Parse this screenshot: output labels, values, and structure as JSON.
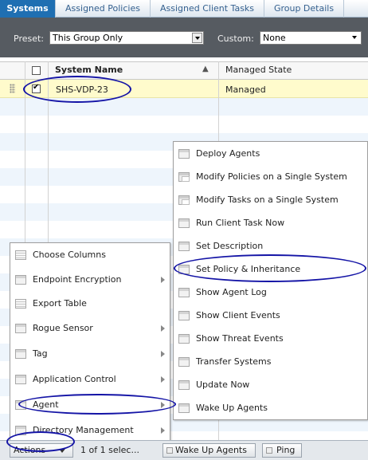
{
  "tabs": [
    {
      "label": "Systems",
      "active": true
    },
    {
      "label": "Assigned Policies",
      "active": false
    },
    {
      "label": "Assigned Client Tasks",
      "active": false
    },
    {
      "label": "Group Details",
      "active": false
    }
  ],
  "preset": {
    "label": "Preset:",
    "value": "This Group Only"
  },
  "custom": {
    "label": "Custom:",
    "value": "None"
  },
  "grid": {
    "columns": [
      {
        "label": "System Name",
        "sort": "ascending"
      },
      {
        "label": "Managed State"
      }
    ],
    "rows": [
      {
        "system_name": "SHS-VDP-23",
        "managed_state": "Managed",
        "checked": true
      }
    ]
  },
  "agent_submenu": {
    "items": [
      {
        "label": "Deploy Agents",
        "icon": "window-icon"
      },
      {
        "label": "Modify Policies on a Single System",
        "icon": "system-icon"
      },
      {
        "label": "Modify Tasks on a Single System",
        "icon": "system-icon"
      },
      {
        "label": "Run Client Task Now",
        "icon": "window-icon"
      },
      {
        "label": "Set Description",
        "icon": "window-icon"
      },
      {
        "label": "Set Policy & Inheritance",
        "icon": "window-icon"
      },
      {
        "label": "Show Agent Log",
        "icon": "window-icon"
      },
      {
        "label": "Show Client Events",
        "icon": "window-icon"
      },
      {
        "label": "Show Threat Events",
        "icon": "window-icon"
      },
      {
        "label": "Transfer Systems",
        "icon": "window-icon"
      },
      {
        "label": "Update Now",
        "icon": "window-icon"
      },
      {
        "label": "Wake Up Agents",
        "icon": "window-icon"
      }
    ]
  },
  "actions_menu": {
    "items": [
      {
        "label": "Choose Columns",
        "icon": "document-icon",
        "submenu": false
      },
      {
        "label": "Endpoint Encryption",
        "icon": "window-icon",
        "submenu": true
      },
      {
        "label": "Export Table",
        "icon": "document-icon",
        "submenu": false
      },
      {
        "label": "Rogue Sensor",
        "icon": "window-icon",
        "submenu": true
      },
      {
        "label": "Tag",
        "icon": "window-icon",
        "submenu": true
      },
      {
        "label": "Application Control",
        "icon": "window-icon",
        "submenu": true
      },
      {
        "label": "Agent",
        "icon": "window-icon",
        "submenu": true
      },
      {
        "label": "Directory Management",
        "icon": "window-icon",
        "submenu": true
      }
    ]
  },
  "footer": {
    "actions_label": "Actions",
    "selection_status": "1 of 1 selec...",
    "wake_up_agents_label": "Wake Up Agents",
    "ping_label": "Ping"
  },
  "highlighted": [
    "SHS-VDP-23",
    "Set Policy & Inheritance",
    "Agent",
    "Actions"
  ],
  "colors": {
    "tab_active": "#1f6fb2",
    "preset_bar": "#565b61",
    "selected_row": "#fffbcc",
    "annotation": "#1414a6"
  }
}
